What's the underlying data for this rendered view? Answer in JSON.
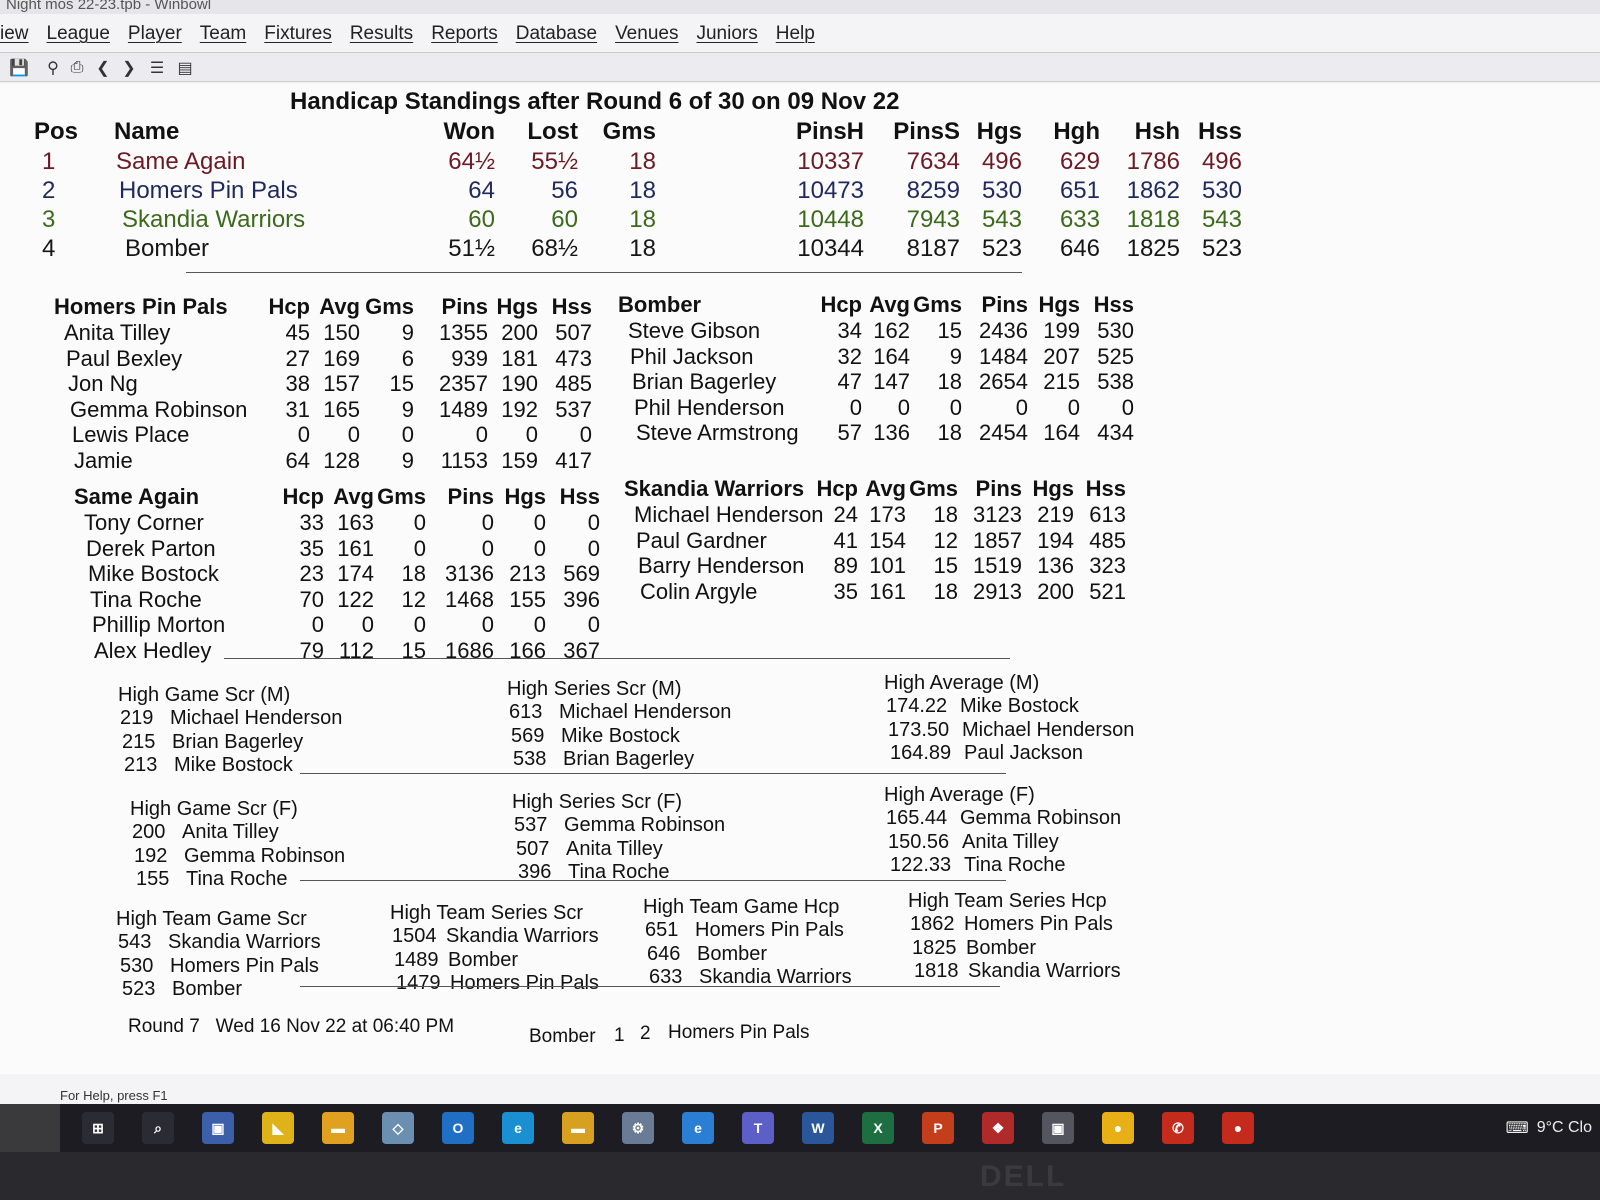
{
  "window": {
    "title": "Night mos 22-23.tpb - Winbowl"
  },
  "menu": [
    "iew",
    "League",
    "Player",
    "Team",
    "Fixtures",
    "Results",
    "Reports",
    "Database",
    "Venues",
    "Juniors",
    "Help"
  ],
  "report": {
    "title": "Handicap Standings after Round 6 of 30 on 09 Nov 22",
    "standings": {
      "headers": [
        "Pos",
        "Name",
        "Won",
        "Lost",
        "Gms",
        "PinsH",
        "PinsS",
        "Hgs",
        "Hgh",
        "Hsh",
        "Hss"
      ],
      "rows": [
        [
          "1",
          "Same Again",
          "64½",
          "55½",
          "18",
          "10337",
          "7634",
          "496",
          "629",
          "1786",
          "496"
        ],
        [
          "2",
          "Homers Pin Pals",
          "64",
          "56",
          "18",
          "10473",
          "8259",
          "530",
          "651",
          "1862",
          "530"
        ],
        [
          "3",
          "Skandia Warriors",
          "60",
          "60",
          "18",
          "10448",
          "7943",
          "543",
          "633",
          "1818",
          "543"
        ],
        [
          "4",
          "Bomber",
          "51½",
          "68½",
          "18",
          "10344",
          "8187",
          "523",
          "646",
          "1825",
          "523"
        ]
      ],
      "row_colors": [
        "#6b1a24",
        "#1f2a5c",
        "#3b6a1c",
        "#161616"
      ]
    },
    "teams": [
      {
        "name": "Homers Pin Pals",
        "headers": [
          "Hcp",
          "Avg",
          "Gms",
          "Pins",
          "Hgs",
          "Hss"
        ],
        "players": [
          [
            "Anita Tilley",
            "45",
            "150",
            "9",
            "1355",
            "200",
            "507"
          ],
          [
            "Paul Bexley",
            "27",
            "169",
            "6",
            "939",
            "181",
            "473"
          ],
          [
            "Jon Ng",
            "38",
            "157",
            "15",
            "2357",
            "190",
            "485"
          ],
          [
            "Gemma Robinson",
            "31",
            "165",
            "9",
            "1489",
            "192",
            "537"
          ],
          [
            "Lewis Place",
            "0",
            "0",
            "0",
            "0",
            "0",
            "0"
          ],
          [
            "Jamie",
            "64",
            "128",
            "9",
            "1153",
            "159",
            "417"
          ]
        ]
      },
      {
        "name": "Bomber",
        "headers": [
          "Hcp",
          "Avg",
          "Gms",
          "Pins",
          "Hgs",
          "Hss"
        ],
        "players": [
          [
            "Steve Gibson",
            "34",
            "162",
            "15",
            "2436",
            "199",
            "530"
          ],
          [
            "Phil Jackson",
            "32",
            "164",
            "9",
            "1484",
            "207",
            "525"
          ],
          [
            "Brian Bagerley",
            "47",
            "147",
            "18",
            "2654",
            "215",
            "538"
          ],
          [
            "Phil Henderson",
            "0",
            "0",
            "0",
            "0",
            "0",
            "0"
          ],
          [
            "Steve Armstrong",
            "57",
            "136",
            "18",
            "2454",
            "164",
            "434"
          ]
        ]
      },
      {
        "name": "Same Again",
        "headers": [
          "Hcp",
          "Avg",
          "Gms",
          "Pins",
          "Hgs",
          "Hss"
        ],
        "players": [
          [
            "Tony Corner",
            "33",
            "163",
            "0",
            "0",
            "0",
            "0"
          ],
          [
            "Derek Parton",
            "35",
            "161",
            "0",
            "0",
            "0",
            "0"
          ],
          [
            "Mike Bostock",
            "23",
            "174",
            "18",
            "3136",
            "213",
            "569"
          ],
          [
            "Tina Roche",
            "70",
            "122",
            "12",
            "1468",
            "155",
            "396"
          ],
          [
            "Phillip Morton",
            "0",
            "0",
            "0",
            "0",
            "0",
            "0"
          ],
          [
            "Alex Hedley",
            "79",
            "112",
            "15",
            "1686",
            "166",
            "367"
          ]
        ]
      },
      {
        "name": "Skandia Warriors",
        "headers": [
          "Hcp",
          "Avg",
          "Gms",
          "Pins",
          "Hgs",
          "Hss"
        ],
        "players": [
          [
            "Michael Henderson",
            "24",
            "173",
            "18",
            "3123",
            "219",
            "613"
          ],
          [
            "Paul Gardner",
            "41",
            "154",
            "12",
            "1857",
            "194",
            "485"
          ],
          [
            "Barry Henderson",
            "89",
            "101",
            "15",
            "1519",
            "136",
            "323"
          ],
          [
            "Colin Argyle",
            "35",
            "161",
            "18",
            "2913",
            "200",
            "521"
          ]
        ]
      }
    ],
    "highs_men": [
      {
        "title": "High Game Scr (M)",
        "entries": [
          [
            "219",
            "Michael Henderson"
          ],
          [
            "215",
            "Brian Bagerley"
          ],
          [
            "213",
            "Mike Bostock"
          ]
        ]
      },
      {
        "title": "High Series Scr (M)",
        "entries": [
          [
            "613",
            "Michael Henderson"
          ],
          [
            "569",
            "Mike Bostock"
          ],
          [
            "538",
            "Brian Bagerley"
          ]
        ]
      },
      {
        "title": "High Average (M)",
        "entries": [
          [
            "174.22",
            "Mike Bostock"
          ],
          [
            "173.50",
            "Michael Henderson"
          ],
          [
            "164.89",
            "Paul Jackson"
          ]
        ]
      }
    ],
    "highs_women": [
      {
        "title": "High Game Scr (F)",
        "entries": [
          [
            "200",
            "Anita Tilley"
          ],
          [
            "192",
            "Gemma Robinson"
          ],
          [
            "155",
            "Tina Roche"
          ]
        ]
      },
      {
        "title": "High Series Scr (F)",
        "entries": [
          [
            "537",
            "Gemma Robinson"
          ],
          [
            "507",
            "Anita Tilley"
          ],
          [
            "396",
            "Tina Roche"
          ]
        ]
      },
      {
        "title": "High Average (F)",
        "entries": [
          [
            "165.44",
            "Gemma Robinson"
          ],
          [
            "150.56",
            "Anita Tilley"
          ],
          [
            "122.33",
            "Tina Roche"
          ]
        ]
      }
    ],
    "highs_team": [
      {
        "title": "High Team Game Scr",
        "entries": [
          [
            "543",
            "Skandia Warriors"
          ],
          [
            "530",
            "Homers Pin Pals"
          ],
          [
            "523",
            "Bomber"
          ]
        ]
      },
      {
        "title": "High Team Series Scr",
        "entries": [
          [
            "1504",
            "Skandia Warriors"
          ],
          [
            "1489",
            "Bomber"
          ],
          [
            "1479",
            "Homers Pin Pals"
          ]
        ]
      },
      {
        "title": "High Team Game Hcp",
        "entries": [
          [
            "651",
            "Homers Pin Pals"
          ],
          [
            "646",
            "Bomber"
          ],
          [
            "633",
            "Skandia Warriors"
          ]
        ]
      },
      {
        "title": "High Team Series Hcp",
        "entries": [
          [
            "1862",
            "Homers Pin Pals"
          ],
          [
            "1825",
            "Bomber"
          ],
          [
            "1818",
            "Skandia Warriors"
          ]
        ]
      }
    ],
    "next_round": {
      "label": "Round 7   Wed 16 Nov 22 at 06:40 PM",
      "fixture": [
        "Bomber",
        "1",
        "2",
        "Homers Pin Pals"
      ]
    }
  },
  "status": {
    "text": "For Help, press F1"
  },
  "tray": {
    "weather": "9°C Clo"
  },
  "bezel": {
    "brand": "DELL"
  },
  "icons": {
    "toolbar": [
      "save-icon",
      "preview-icon",
      "print-icon",
      "back-icon",
      "forward-icon",
      "list-icon",
      "report-icon"
    ],
    "taskbar": [
      "start-icon",
      "search-icon",
      "app-icon",
      "notes-icon",
      "file-explorer-icon",
      "app-icon",
      "outlook-icon",
      "edge-icon",
      "app-icon",
      "app-icon",
      "ie-icon",
      "teams-icon",
      "word-icon",
      "excel-icon",
      "powerpoint-icon",
      "app-icon",
      "app-icon",
      "chrome-icon",
      "acrobat-icon",
      "app-icon"
    ]
  }
}
